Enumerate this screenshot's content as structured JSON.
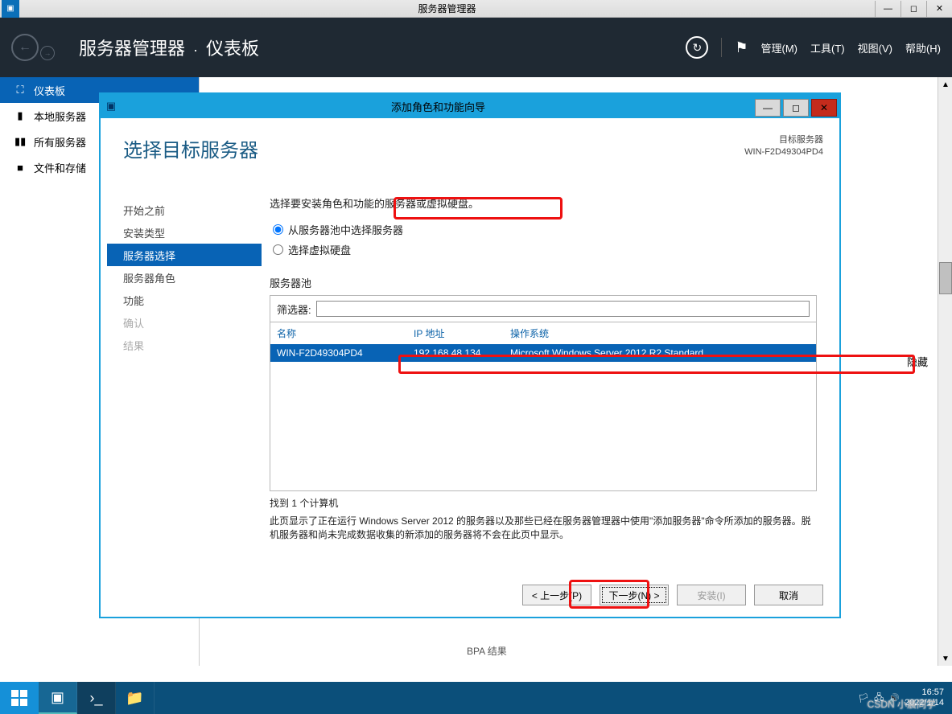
{
  "window": {
    "title": "服务器管理器",
    "controls": {
      "min": "—",
      "max": "◻",
      "close": "✕"
    }
  },
  "header": {
    "crumb1": "服务器管理器",
    "crumb2": "仪表板",
    "menu": {
      "manage": "管理(M)",
      "tools": "工具(T)",
      "view": "视图(V)",
      "help": "帮助(H)"
    }
  },
  "leftnav": {
    "items": [
      {
        "icon": "⛶",
        "label": "仪表板"
      },
      {
        "icon": "▮",
        "label": "本地服务器"
      },
      {
        "icon": "▮▮",
        "label": "所有服务器"
      },
      {
        "icon": "■",
        "label": "文件和存储"
      }
    ]
  },
  "main": {
    "bpa": "BPA 结果",
    "hide": "隐藏"
  },
  "wizard": {
    "title": "添加角色和功能向导",
    "heading": "选择目标服务器",
    "target_label": "目标服务器",
    "target_value": "WIN-F2D49304PD4",
    "steps": [
      {
        "label": "开始之前",
        "state": ""
      },
      {
        "label": "安装类型",
        "state": ""
      },
      {
        "label": "服务器选择",
        "state": "active"
      },
      {
        "label": "服务器角色",
        "state": ""
      },
      {
        "label": "功能",
        "state": ""
      },
      {
        "label": "确认",
        "state": "disabled"
      },
      {
        "label": "结果",
        "state": "disabled"
      }
    ],
    "instruction": "选择要安装角色和功能的服务器或虚拟硬盘。",
    "radio1": "从服务器池中选择服务器",
    "radio2": "选择虚拟硬盘",
    "pool_label": "服务器池",
    "filter_label": "筛选器:",
    "filter_value": "",
    "columns": {
      "name": "名称",
      "ip": "IP 地址",
      "os": "操作系统"
    },
    "row": {
      "name": "WIN-F2D49304PD4",
      "ip": "192.168.48.134",
      "os": "Microsoft Windows Server 2012 R2 Standard"
    },
    "found": "找到 1 个计算机",
    "desc": "此页显示了正在运行 Windows Server 2012 的服务器以及那些已经在服务器管理器中使用\"添加服务器\"命令所添加的服务器。脱机服务器和尚未完成数据收集的新添加的服务器将不会在此页中显示。",
    "buttons": {
      "prev": "< 上一步(P)",
      "next": "下一步(N) >",
      "install": "安装(I)",
      "cancel": "取消"
    }
  },
  "taskbar": {
    "time": "16:57",
    "date": "2022/1/14",
    "watermark": "CSDN 小晨同学"
  }
}
